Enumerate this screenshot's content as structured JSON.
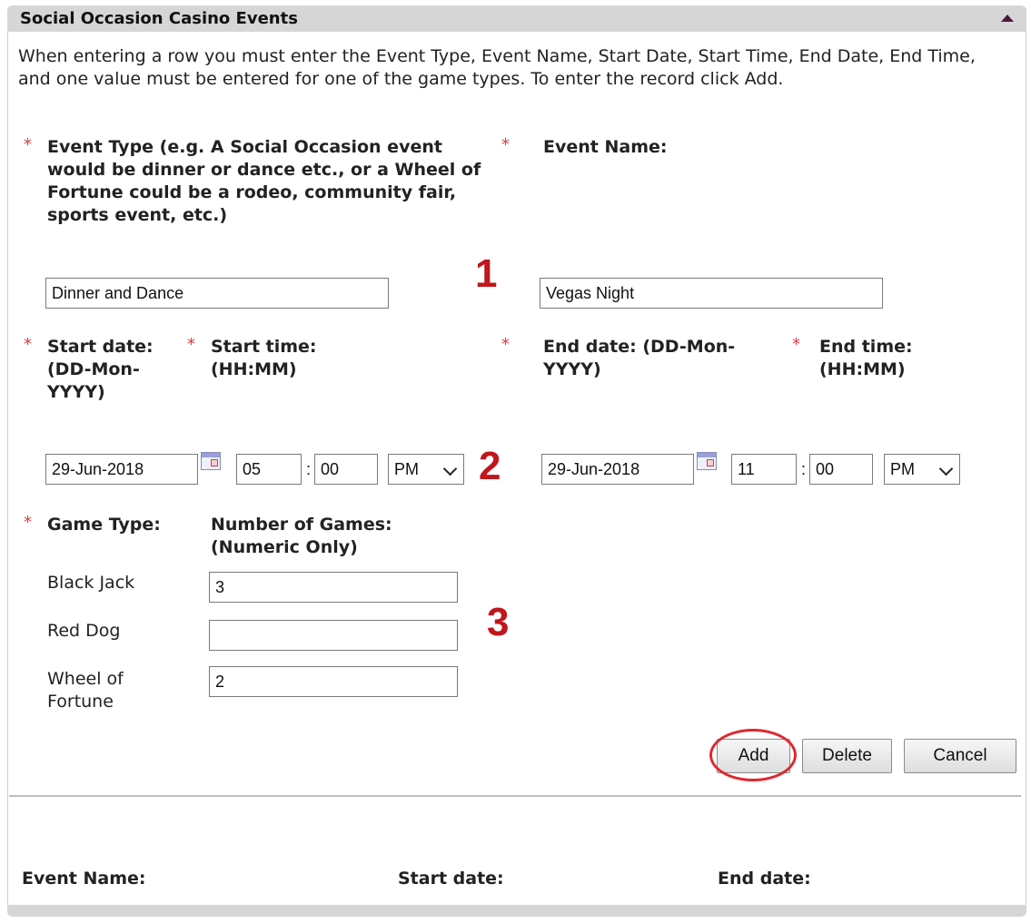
{
  "panel": {
    "title": "Social Occasion Casino Events",
    "instructions": "When entering a row you must enter the Event Type, Event Name, Start Date, Start Time, End Date, End Time, and one value must be entered for one of the game types. To enter the record click Add."
  },
  "required_marker": "*",
  "event_type": {
    "label": "Event Type (e.g. A Social Occasion event would be dinner or dance etc., or a Wheel of Fortune could be a rodeo, community fair, sports event, etc.)",
    "value": "Dinner and Dance"
  },
  "event_name": {
    "label": "Event Name:",
    "value": "Vegas Night"
  },
  "start": {
    "date_label": "Start date: (DD-Mon-YYYY)",
    "time_label": "Start time: (HH:MM)",
    "date": "29-Jun-2018",
    "hour": "05",
    "minute": "00",
    "ampm": "PM"
  },
  "end": {
    "date_label": "End date: (DD-Mon-YYYY)",
    "time_label": "End time: (HH:MM)",
    "date": "29-Jun-2018",
    "hour": "11",
    "minute": "00",
    "ampm": "PM"
  },
  "time_separator": ":",
  "games": {
    "type_header": "Game Type:",
    "count_header": "Number of Games: (Numeric Only)",
    "rows": [
      {
        "name": "Black Jack",
        "value": "3"
      },
      {
        "name": "Red Dog",
        "value": ""
      },
      {
        "name": "Wheel of Fortune",
        "value": "2"
      }
    ]
  },
  "annotations": [
    "1",
    "2",
    "3"
  ],
  "buttons": {
    "add": "Add",
    "delete": "Delete",
    "cancel": "Cancel"
  },
  "list_headers": {
    "event_name": "Event Name:",
    "start_date": "Start date:",
    "end_date": "End date:"
  },
  "colors": {
    "required": "#e0383e",
    "annotation": "#c0161c",
    "header_bg": "#d6d6d6",
    "collapse_arrow": "#4a1a3c"
  },
  "icons": {
    "collapse": "triangle-up-icon",
    "calendar": "calendar-icon",
    "dropdown": "chevron-down-icon"
  }
}
